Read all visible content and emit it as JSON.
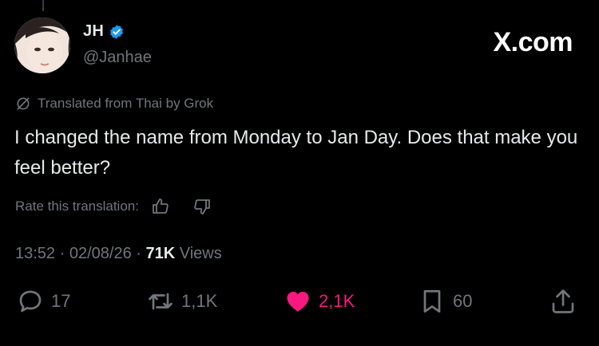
{
  "author": {
    "name": "JH",
    "handle": "@Janhae",
    "verified": true
  },
  "brand": "X.com",
  "translation_note": "Translated from Thai by Grok",
  "tweet_text": "I changed the name from Monday to Jan Day. Does that make you feel better?",
  "rate": {
    "label": "Rate this translation:",
    "up_icon": "thumbs-up-icon",
    "down_icon": "thumbs-down-icon"
  },
  "meta": {
    "time": "13:52",
    "date": "02/08/26",
    "views_count": "71K",
    "views_label": "Views"
  },
  "actions": {
    "replies": "17",
    "reposts": "1,1K",
    "likes": "2,1K",
    "bookmarks": "60"
  },
  "colors": {
    "background": "#000000",
    "text": "#e7e9ea",
    "muted": "#71767b",
    "verified": "#1d9bf0",
    "like": "#f91880"
  }
}
